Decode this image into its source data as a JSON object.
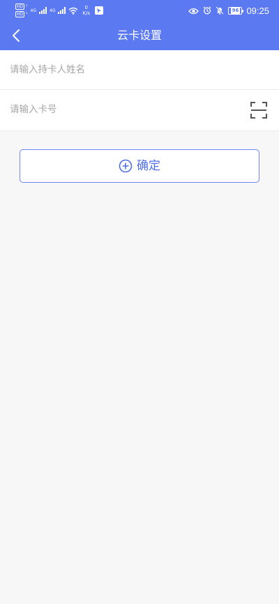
{
  "status_bar": {
    "sim1_badge": "HD",
    "sim2_badge": "HD",
    "network1": "4G",
    "network2": "4G",
    "net_speed_value": "0",
    "net_speed_unit": "K/s",
    "battery_level": "96",
    "time": "09:25",
    "icons": [
      "eye-icon",
      "alarm-icon",
      "mute-icon",
      "battery-icon"
    ]
  },
  "header": {
    "title": "云卡设置",
    "back_icon": "chevron-left-icon"
  },
  "form": {
    "cardholder_name": {
      "value": "",
      "placeholder": "请输入持卡人姓名"
    },
    "card_number": {
      "value": "",
      "placeholder": "请输入卡号",
      "action_icon": "scan-icon"
    }
  },
  "confirm_button": {
    "label": "确定",
    "icon": "plus-circle-icon"
  },
  "colors": {
    "primary": "#5b79f0",
    "button_text": "#4f6fe8",
    "button_border": "#6d88f2",
    "background": "#f7f7f7",
    "placeholder": "#a6a6a6",
    "divider": "#ececec"
  }
}
